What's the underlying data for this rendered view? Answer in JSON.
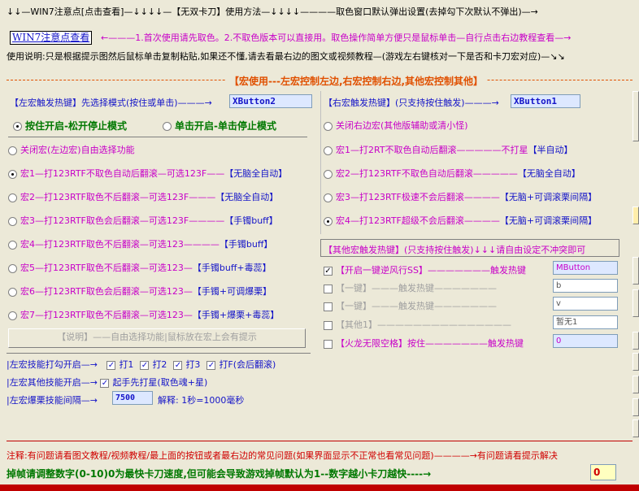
{
  "header": {
    "line1": "↓↓—WIN7注意点[点击查看]—↓↓↓↓—【无双卡刀】使用方法—↓↓↓↓————取色窗口默认弹出设置(去掉勾下次默认不弹出)—→",
    "win7_button": "WIN7注意点查看",
    "line2_hint": "←———1.首次使用请先取色。2.不取色版本可以直接用。取色操作简单方便只是鼠标单击—自行点击右边教程查看—→",
    "usage": "使用说明:只是根据提示图然后鼠标单击复制粘贴,如果还不懂,请去看最右边的图文或视频教程—(游戏左右键核对一下是否和卡刀宏对应)—↘↘"
  },
  "macro_banner": "【宏使用---左宏控制左边,右宏控制右边,其他宏控制其他】",
  "left": {
    "hotkey_label": "【左宏触发热键】先选择模式(按住或单击)———→",
    "hotkey_value": "XButton2",
    "mode_hold": "按住开启-松开停止模式",
    "mode_click": "单击开启-单击停止模式",
    "items": [
      {
        "text": "关闭宏(左边宏)自由选择功能",
        "tag": "",
        "checked": false
      },
      {
        "text": "宏1—打123RTF不取色自动后翻滚—可选123F——",
        "tag": "【无脑全自动】",
        "checked": true
      },
      {
        "text": "宏2—打123RTF取色不后翻滚—可选123F———",
        "tag": "【无脑全自动】",
        "checked": false
      },
      {
        "text": "宏3—打123RTF取色会后翻滚—可选123F————",
        "tag": "【手镯buff】",
        "checked": false
      },
      {
        "text": "宏4—打123RTF取色不后翻滚—可选123————",
        "tag": "【手镯buff】",
        "checked": false
      },
      {
        "text": "宏5—打123RTF取色不后翻滚—可选123—",
        "tag": "【手镯buff+毒蕊】",
        "checked": false
      },
      {
        "text": "宏6—打123RTF取色会后翻滚—可选123—",
        "tag": "【手镯+可调爆栗】",
        "checked": false
      },
      {
        "text": "宏7—打123RTF取色不后翻滚—可选123—",
        "tag": "【手镯+爆栗+毒蕊】",
        "checked": false
      }
    ],
    "explain_button": "【说明】——自由选择功能|鼠标放在宏上会有提示"
  },
  "right": {
    "hotkey_label": "【右宏触发热键】(只支持按住触发)———→",
    "hotkey_value": "XButton1",
    "items": [
      {
        "text": "关闭右边宏(其他版辅助或清小怪)",
        "tag": "",
        "checked": false
      },
      {
        "text": "宏1—打2RT不取色自动后翻滚—————不打星",
        "tag": "【半自动】",
        "checked": false
      },
      {
        "text": "宏2—打123RTF不取色自动后翻滚—————",
        "tag": "【无脑全自动】",
        "checked": false
      },
      {
        "text": "宏3—打123RTF极速不会后翻滚————",
        "tag": "【无脑+可调滚栗间隔】",
        "checked": false
      },
      {
        "text": "宏4—打123RTF超级不会后翻滚————",
        "tag": "【无脑+可调滚栗间隔】",
        "checked": true
      }
    ],
    "other_header": "【其他宏触发热键】(只支持按住触发)↓↓↓请自由设定不冲突即可",
    "other_items": [
      {
        "label": "【开启一键逆风行SS】———————触发热键",
        "value": "MButton",
        "checked": true,
        "style": "magenta"
      },
      {
        "label": "【一键】———触发热键———————",
        "value": "b",
        "checked": false,
        "style": "gray"
      },
      {
        "label": "【一键】———触发热键———————",
        "value": "v",
        "checked": false,
        "style": "gray"
      },
      {
        "label": "【其他1】———————————————",
        "value": "暂无1",
        "checked": false,
        "style": "gray"
      },
      {
        "label": "【火龙无限空格】按住———————触发热键",
        "value": "0",
        "checked": false,
        "style": "magenta"
      }
    ]
  },
  "settings": {
    "row1_label": "|左宏技能打勾开启—→",
    "row1_checks": [
      {
        "label": "打1",
        "checked": true
      },
      {
        "label": "打2",
        "checked": true
      },
      {
        "label": "打3",
        "checked": true
      },
      {
        "label": "打F(会后翻滚)",
        "checked": true
      }
    ],
    "row2_label": "|左宏其他技能开启—→",
    "row2_check": {
      "label": "起手先打星(取色魂+星)",
      "checked": true
    },
    "row3_label": "|左宏爆栗技能间隔—→",
    "row3_value": "7500",
    "row3_note": "解释: 1秒=1000毫秒"
  },
  "footer": {
    "note": "注释:有问题请看图文教程/视频教程/最上面的按钮或者最右边的常见问题(如果界面显示不正常也看常见问题)————→有问题请看提示解决",
    "frame_drop": "掉帧请调整数字(0-10)0为最快卡刀速度,但可能会导致游戏掉帧默认为1--数字越小卡刀越快----→",
    "frame_value": "0"
  }
}
